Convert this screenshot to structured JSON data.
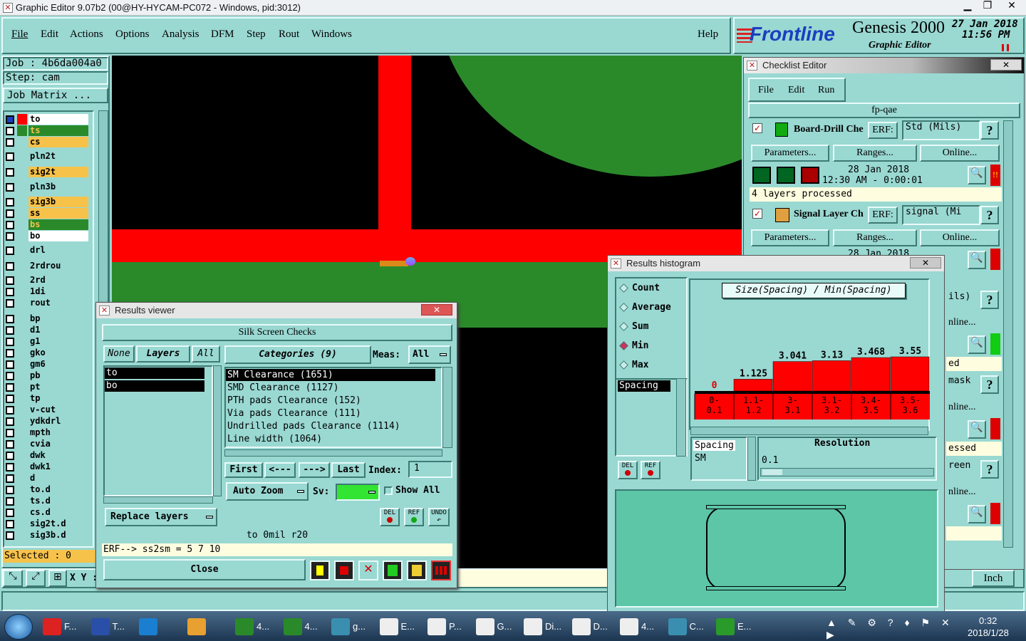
{
  "app_title": "Graphic Editor 9.07b2 (00@HY-HYCAM-PC072 - Windows, pid:3012)",
  "menu": [
    "File",
    "Edit",
    "Actions",
    "Options",
    "Analysis",
    "DFM",
    "Step",
    "Rout",
    "Windows"
  ],
  "help": "Help",
  "brand": {
    "logo": "Frontline",
    "product": "Genesis 2000",
    "subtitle": "Graphic Editor",
    "date": "27 Jan 2018",
    "time": "11:56 PM"
  },
  "job": "Job : 4b6da004a0",
  "step": "Step: cam",
  "job_matrix": "Job Matrix ...",
  "layers": [
    "to",
    "ts",
    "cs",
    "pln2t",
    "sig2t",
    "pln3b",
    "sig3b",
    "ss",
    "bs",
    "bo",
    "drl",
    "2rdrou",
    "2rd",
    "1di",
    "rout",
    "bp",
    "d1",
    "g1",
    "gko",
    "gm6",
    "pb",
    "pt",
    "tp",
    "v-cut",
    "ydkdrl",
    "mpth",
    "cvia",
    "dwk",
    "dwk1",
    "d",
    "to.d",
    "ts.d",
    "cs.d",
    "sig2t.d",
    "sig3b.d"
  ],
  "selected": "Selected : 0",
  "xy_label": "X Y :",
  "units": "Inch",
  "checklist": {
    "title": "Checklist Editor",
    "menu": [
      "File",
      "Edit",
      "Run"
    ],
    "name": "fp-qae",
    "items": [
      {
        "name": "Board-Drill Che",
        "erf": "ERF:",
        "erf_value": "Std (Mils)",
        "date": "28 Jan 2018",
        "time": "12:30 AM - 0:00:01",
        "status": "4 layers processed"
      },
      {
        "name": "Signal Layer Ch",
        "erf": "ERF:",
        "erf_value": "signal (Mi",
        "date": "28 Jan 2018"
      }
    ],
    "buttons": [
      "Parameters...",
      "Ranges...",
      "Online..."
    ],
    "hidden_fragments": [
      "ils)",
      "nline...",
      "ed",
      "mask",
      "nline...",
      "essed",
      "reen",
      "nline..."
    ],
    "question": "?"
  },
  "results_viewer": {
    "title": "Results viewer",
    "header": "Silk Screen Checks",
    "none": "None",
    "layers": "Layers",
    "all": "All",
    "categories_label": "Categories (9)",
    "meas_label": "Meas:",
    "meas_value": "All",
    "layer_items": [
      "to",
      "bo"
    ],
    "categories": [
      "SM Clearance (1651)",
      "SMD Clearance (1127)",
      "PTH pads Clearance (152)",
      "Via pads Clearance (111)",
      "Undrilled pads Clearance (1114)",
      "Line width (1064)"
    ],
    "nav": [
      "First",
      "<---",
      "--->",
      "Last"
    ],
    "index_label": "Index:",
    "index_value": "1",
    "auto_zoom": "Auto Zoom",
    "sv": "Sv:",
    "show_all": "Show All",
    "replace_layers": "Replace layers",
    "del": "DEL",
    "ref": "REF",
    "undo": "UNDO",
    "info": "to  0mil  r20",
    "erf": "ERF--> ss2sm = 5 7 10",
    "close": "Close"
  },
  "histogram": {
    "title": "Results histogram",
    "modes": [
      "Count",
      "Average",
      "Sum",
      "Min",
      "Max"
    ],
    "selected_mode": "Min",
    "chart_title": "Size(Spacing) / Min(Spacing)",
    "list_item": "Spacing",
    "del": "DEL",
    "ref": "REF",
    "res_items": [
      "Spacing",
      "SM"
    ],
    "resolution_label": "Resolution",
    "resolution_value": "0.1"
  },
  "chart_data": {
    "type": "bar",
    "title": "Size(Spacing) / Min(Spacing)",
    "categories": [
      "0-0.1",
      "1.1-1.2",
      "3-3.1",
      "3.1-3.2",
      "3.4-3.5",
      "3.5-3.6"
    ],
    "category_lines": [
      [
        "0-",
        "0.1"
      ],
      [
        "1.1-",
        "1.2"
      ],
      [
        "3-",
        "3.1"
      ],
      [
        "3.1-",
        "3.2"
      ],
      [
        "3.4-",
        "3.5"
      ],
      [
        "3.5-",
        "3.6"
      ]
    ],
    "values": [
      0,
      1.125,
      3.041,
      3.13,
      3.468,
      3.55
    ],
    "value_labels": [
      "0",
      "1.125",
      "3.041",
      "3.13",
      "3.468",
      "3.55"
    ],
    "ylim": [
      0,
      3.55
    ],
    "bar_color": "#ff0000"
  },
  "taskbar": {
    "items": [
      "F...",
      "T...",
      "",
      "",
      "4...",
      "4...",
      "g...",
      "E...",
      "P...",
      "G...",
      "Di...",
      "D...",
      "4...",
      "C...",
      "E..."
    ],
    "time": "0:32",
    "date": "2018/1/28"
  },
  "colors": {
    "panel": "#9ad8d2",
    "green_layer": "#2a8a2a",
    "red_layer": "#ff0000",
    "yellow_layer": "#f7c24a"
  }
}
